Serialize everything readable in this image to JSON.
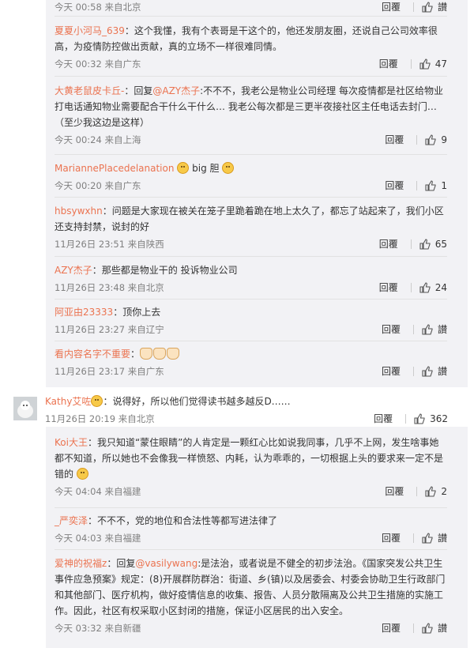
{
  "labels": {
    "reply": "回覆",
    "like_word": "讃"
  },
  "comments": [
    {
      "time": "今天 00:58 来自北京",
      "likes": "讃"
    },
    {
      "nick": "夏夏小河马_639",
      "text": "：这个我懂，我有个表哥是干这个的，他还发朋友圈，还说自己公司效率很高，为疫情防控做出贡献，真的立场不一样很难同情。",
      "time": "今天 00:32 来自广东",
      "likes": "47"
    },
    {
      "nick": "大黄老鼠皮卡丘-",
      "text_a": "：回复",
      "mention": "@AZY杰子",
      "text_b": ":不不不，我老公是物业公司经理 每次疫情都是社区给物业打电话通知物业需要配合干什么干什么… 我老公每次都是三更半夜接社区主任电话去封门… （至少我这边是这样）",
      "time": "今天 00:24 来自上海",
      "likes": "9"
    },
    {
      "nick": "MariannePlacedelanation",
      "text": "big 胆",
      "time": "今天 00:20 来自广东",
      "likes": "1"
    },
    {
      "nick": "hbsywxhn",
      "text": "：问题是大家现在被关在笼子里跪着跪在地上太久了，都忘了站起来了，我们小区还支持封禁，说封的好",
      "time": "11月26日 23:51 来自陕西",
      "likes": "65"
    },
    {
      "nick": "AZY杰子",
      "text": "：那些都是物业干的 投诉物业公司",
      "time": "11月26日 23:48 来自北京",
      "likes": "24"
    },
    {
      "nick": "阿亚由23333",
      "text": "：顶你上去",
      "time": "11月26日 23:27 来自辽宁",
      "likes": "讃"
    },
    {
      "nick": "看内容名字不重要",
      "text": "：",
      "time": "11月26日 23:17 来自广东",
      "likes": "讃"
    },
    {
      "nick": "Kathy艾咗",
      "text": "：说得好，所以他们觉得读书越多越反D……",
      "time": "11月26日 20:19 来自北京",
      "likes": "362"
    },
    {
      "nick": "Koi大王",
      "text": "：我只知道“蒙住眼睛”的人肯定是一颗红心比如说我同事，几乎不上网，发生啥事她都不知道，所以她也不会像我一样愤怒、内耗，认为乖乖的，一切根据上头的要求来一定不是错的",
      "time": "今天 04:04 来自福建",
      "likes": "2"
    },
    {
      "nick": "_严奕泽",
      "text": "：不不不，党的地位和合法性等都写进法律了",
      "time": "今天 04:03 来自福建",
      "likes": "讃"
    },
    {
      "nick": "爱神的祝福z",
      "text_a": "：回复",
      "mention": "@vasilywang",
      "text_b": ":是法治，或者说是不健全的初步法治。《国家突发公共卫生事件应急预案》规定：(8)开展群防群治：街道、乡(镇)以及居委会、村委会协助卫生行政部门和其他部门、医疗机构，做好疫情信息的收集、报告、人员分散隔离及公共卫生措施的实施工作。因此，社区有权采取小区封闭的措施，保证小区居民的出入安全。",
      "time": "今天 03:32 来自新疆",
      "likes": "讃"
    }
  ]
}
